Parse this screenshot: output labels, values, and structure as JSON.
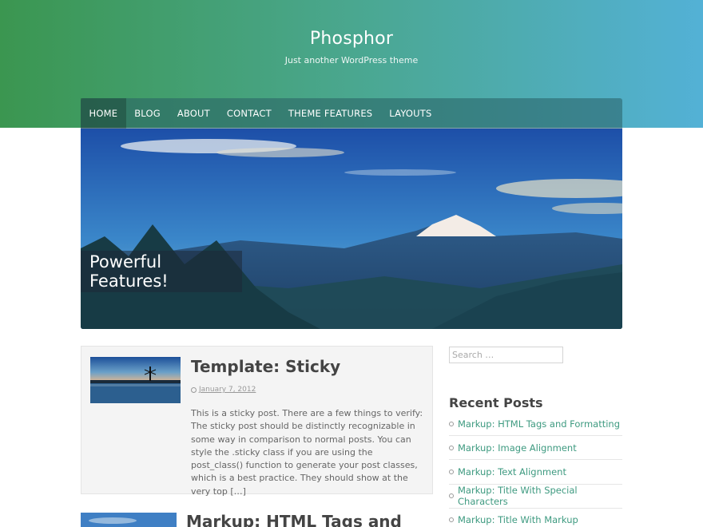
{
  "header": {
    "site_title": "Phosphor",
    "site_description": "Just another WordPress theme"
  },
  "nav": {
    "items": [
      {
        "label": "HOME",
        "active": true
      },
      {
        "label": "BLOG"
      },
      {
        "label": "ABOUT"
      },
      {
        "label": "CONTACT"
      },
      {
        "label": "THEME FEATURES"
      },
      {
        "label": "LAYOUTS"
      }
    ]
  },
  "hero": {
    "caption": "Powerful Features!"
  },
  "posts": [
    {
      "title": "Template: Sticky",
      "date": "January 7, 2012",
      "excerpt": "This is a sticky post. There are a few things to verify: The sticky post should be distinctly recognizable in some way in comparison to normal posts. You can style the .sticky class if you are using the post_class() function to generate your post classes, which is a best practice. They should show at the very top […]",
      "thumb_icon": "windmill-lake-thumbnail"
    },
    {
      "title": "Markup: HTML Tags and",
      "thumb_icon": "sky-thumbnail"
    }
  ],
  "sidebar": {
    "search_placeholder": "Search …",
    "recent_posts_title": "Recent Posts",
    "recent_posts": [
      "Markup: HTML Tags and Formatting",
      "Markup: Image Alignment",
      "Markup: Text Alignment",
      "Markup: Title With Special Characters",
      "Markup: Title With Markup"
    ]
  },
  "colors": {
    "header_gradient_start": "#3b9650",
    "header_gradient_end": "#53b1d6",
    "link": "#3e9a80"
  }
}
